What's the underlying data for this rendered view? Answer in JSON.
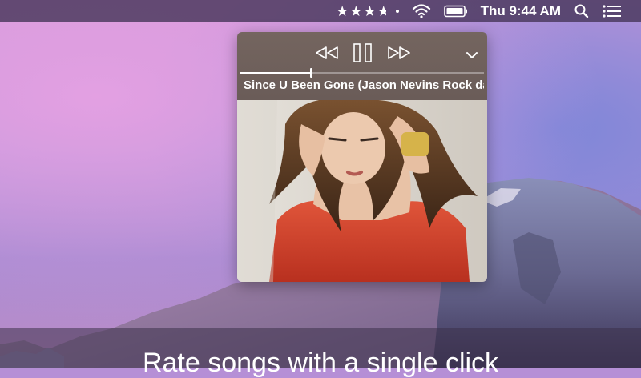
{
  "menubar": {
    "rating_icon": "star-rating-icon",
    "rating_value": 3.5,
    "rating_max": 5,
    "wifi_icon": "wifi-icon",
    "battery_icon": "battery-icon",
    "clock": "Thu 9:44 AM",
    "search_icon": "spotlight-search-icon",
    "menu_icon": "notification-center-icon"
  },
  "player": {
    "controls": {
      "previous_icon": "rewind-icon",
      "play_pause_icon": "pause-icon",
      "next_icon": "fast-forward-icon",
      "expand_icon": "chevron-down-icon"
    },
    "progress": 0.29,
    "song_title": "Since U Been Gone (Jason Nevins Rock da",
    "artwork": "album-artwork"
  },
  "caption": "Rate songs with a single click",
  "colors": {
    "menubar": "#48375c",
    "player_header": "#6f615c"
  }
}
